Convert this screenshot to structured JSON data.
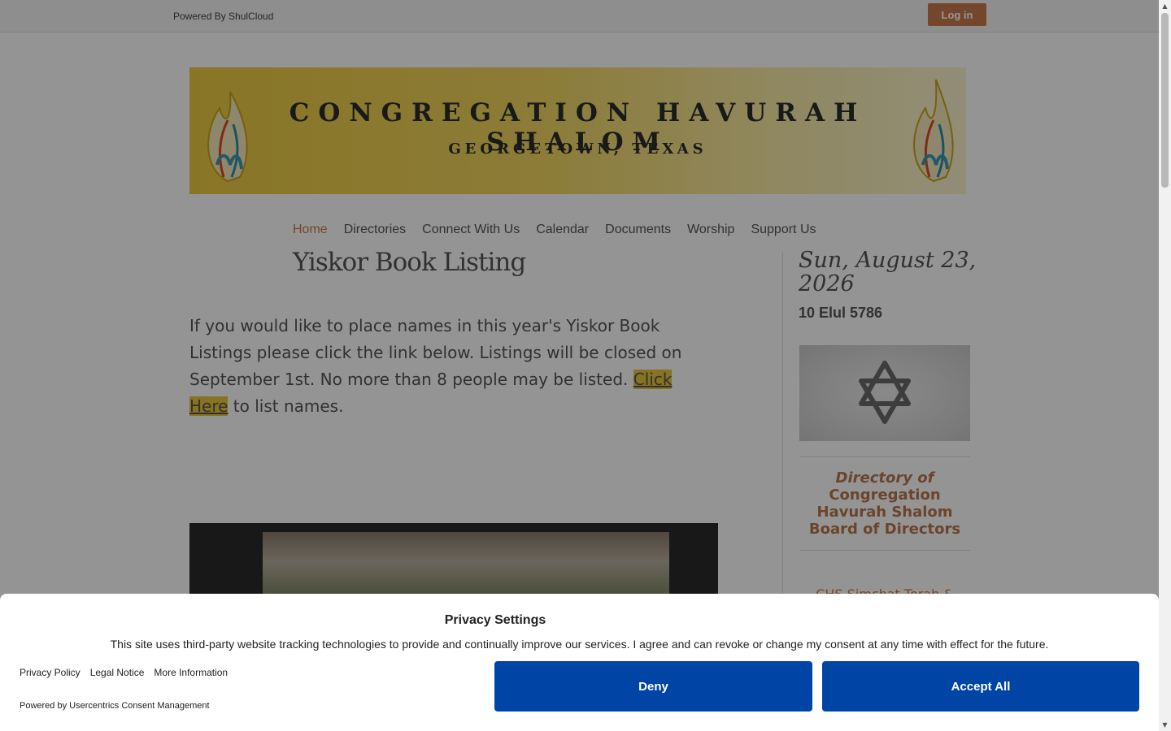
{
  "topbar": {
    "powered_by": "Powered By ShulCloud",
    "login_label": "Log in"
  },
  "banner": {
    "title": "CONGREGATION HAVURAH SHALOM",
    "subtitle": "GEORGETOWN, TEXAS"
  },
  "nav": {
    "items": [
      {
        "label": "Home",
        "active": true
      },
      {
        "label": "Directories"
      },
      {
        "label": "Connect With Us"
      },
      {
        "label": "Calendar"
      },
      {
        "label": "Documents"
      },
      {
        "label": "Worship"
      },
      {
        "label": "Support Us"
      }
    ]
  },
  "main": {
    "title": "Yiskor Book Listing",
    "body_before": "If you would like to place names in this year's Yiskor Book Listings please click the link below.  Listings will be closed on September 1st.  No more than 8 people may be listed.  ",
    "link_text": "Click Here",
    "body_after": " to list names."
  },
  "sidebar": {
    "date": "Sun, August 23, 2026",
    "hebrew_date": "10 Elul 5786",
    "directory_line1": "Directory of",
    "directory_rest": "Congregation Havurah Shalom Board of Directors",
    "peek_text": "CHS Simchat Torah &"
  },
  "consent": {
    "title": "Privacy Settings",
    "description": "This site uses third-party website tracking technologies to provide and continually improve our services. I agree and can revoke or change my consent at any time with effect for the future.",
    "links": [
      "Privacy Policy",
      "Legal Notice",
      "More Information"
    ],
    "powered_by": "Powered by Usercentrics Consent Management",
    "deny_label": "Deny",
    "accept_label": "Accept All"
  },
  "colors": {
    "accent": "#c97a4e",
    "consent_button": "#0045a5",
    "banner_gold": "#ecca41"
  }
}
